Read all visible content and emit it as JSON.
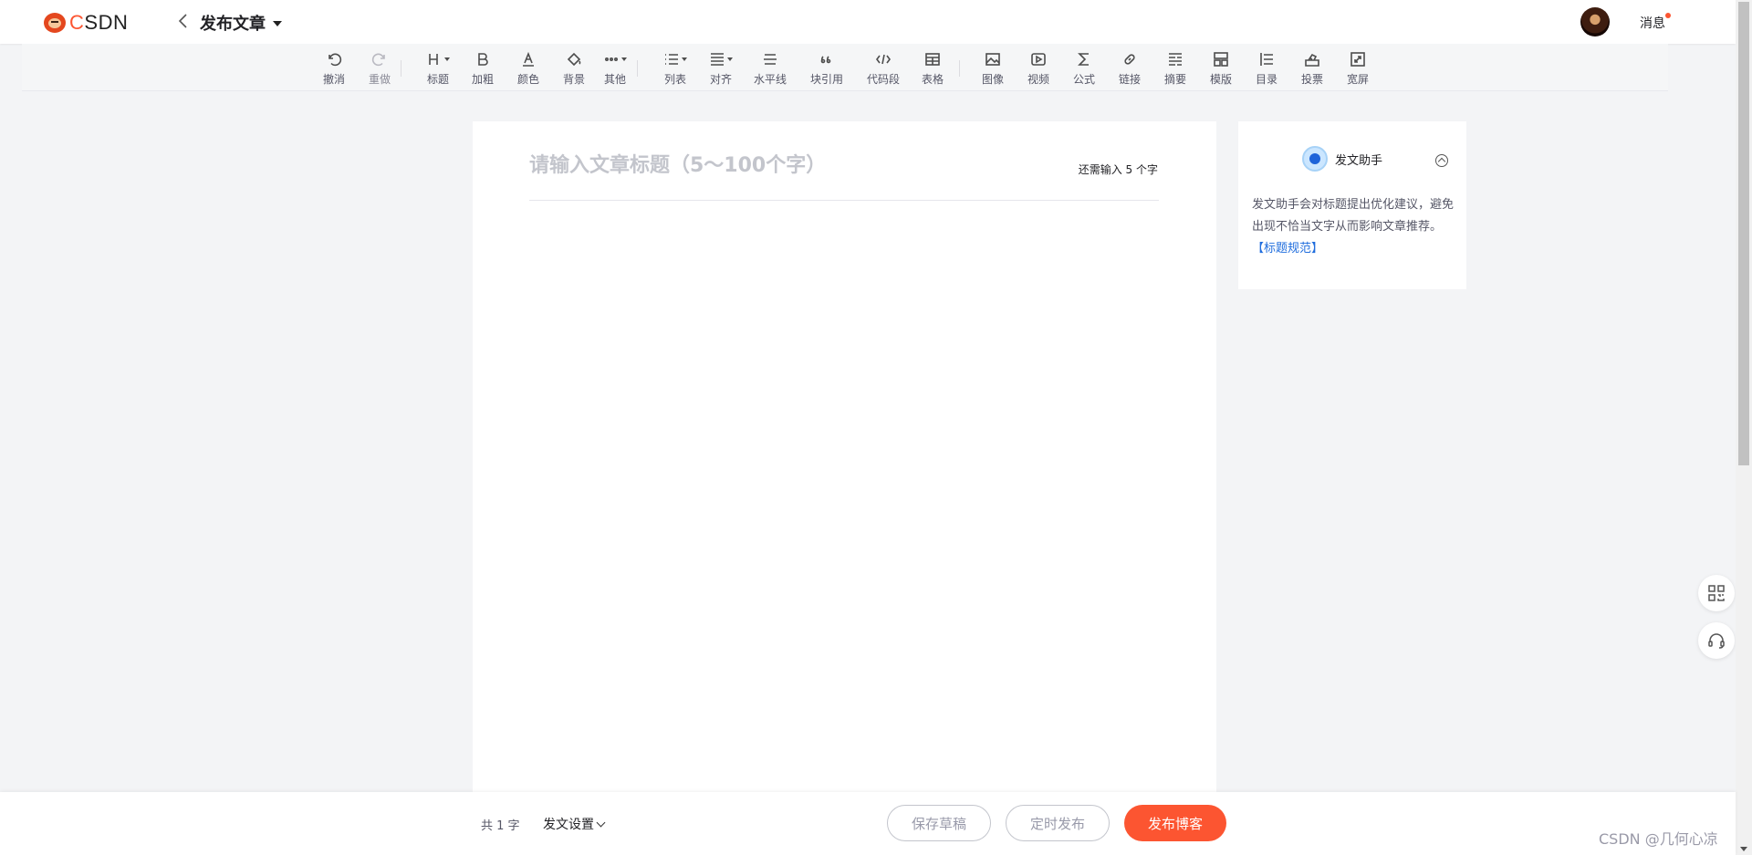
{
  "header": {
    "logo_text_c": "C",
    "logo_text_rest": "SDN",
    "page_title": "发布文章",
    "messages_label": "消息"
  },
  "toolbar": {
    "tools": [
      {
        "name": "undo",
        "label": "撤消",
        "icon": "undo-icon"
      },
      {
        "name": "redo",
        "label": "重做",
        "icon": "redo-icon",
        "disabled": true
      },
      {
        "name": "heading",
        "label": "标题",
        "icon": "heading-icon"
      },
      {
        "name": "bold",
        "label": "加粗",
        "icon": "bold-icon"
      },
      {
        "name": "color",
        "label": "颜色",
        "icon": "text-color-icon"
      },
      {
        "name": "background",
        "label": "背景",
        "icon": "paint-bucket-icon"
      },
      {
        "name": "other",
        "label": "其他",
        "icon": "more-icon"
      },
      {
        "name": "list",
        "label": "列表",
        "icon": "list-icon"
      },
      {
        "name": "align",
        "label": "对齐",
        "icon": "align-icon"
      },
      {
        "name": "hr",
        "label": "水平线",
        "icon": "horizontal-line-icon"
      },
      {
        "name": "quote",
        "label": "块引用",
        "icon": "quote-icon"
      },
      {
        "name": "code",
        "label": "代码段",
        "icon": "code-icon"
      },
      {
        "name": "table",
        "label": "表格",
        "icon": "table-icon"
      },
      {
        "name": "image",
        "label": "图像",
        "icon": "image-icon"
      },
      {
        "name": "video",
        "label": "视频",
        "icon": "video-icon"
      },
      {
        "name": "formula",
        "label": "公式",
        "icon": "sigma-icon"
      },
      {
        "name": "link",
        "label": "链接",
        "icon": "link-icon"
      },
      {
        "name": "summary",
        "label": "摘要",
        "icon": "summary-icon"
      },
      {
        "name": "template",
        "label": "模版",
        "icon": "template-icon"
      },
      {
        "name": "toc",
        "label": "目录",
        "icon": "toc-icon"
      },
      {
        "name": "vote",
        "label": "投票",
        "icon": "vote-icon"
      },
      {
        "name": "widescreen",
        "label": "宽屏",
        "icon": "expand-icon"
      }
    ]
  },
  "editor": {
    "title_placeholder": "请输入文章标题（5～100个字）",
    "remaining_text": "还需输入 5 个字"
  },
  "assistant": {
    "title": "发文助手",
    "description": "发文助手会对标题提出优化建议，避免出现不恰当文字从而影响文章推荐。",
    "link_text": "【标题规范】"
  },
  "bottom": {
    "word_count": "共 1 字",
    "settings_label": "发文设置",
    "save_draft": "保存草稿",
    "schedule": "定时发布",
    "publish": "发布博客"
  },
  "watermark": "CSDN @几何心凉",
  "colors": {
    "brand": "#fc5531",
    "link": "#1e6cdd"
  }
}
